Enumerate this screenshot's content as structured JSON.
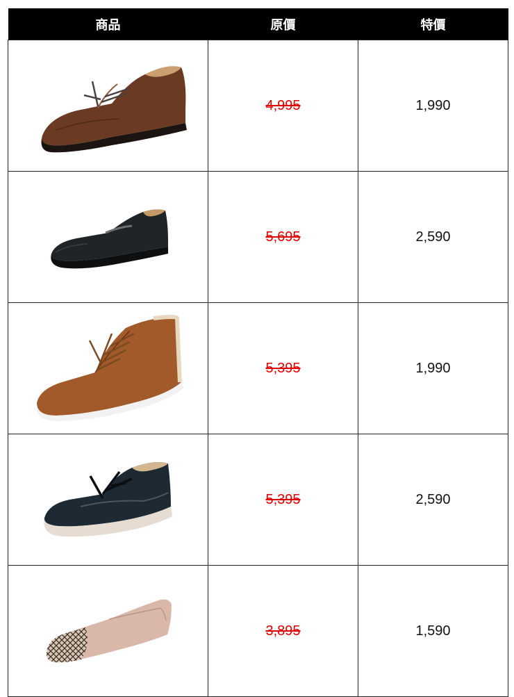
{
  "header": {
    "product": "商品",
    "original_price": "原價",
    "special_price": "特價"
  },
  "rows": [
    {
      "original_price": "4,995",
      "special_price": "1,990",
      "image": "brown-lace-up-dress-shoe"
    },
    {
      "original_price": "5,695",
      "special_price": "2,590",
      "image": "black-slip-on-loafer"
    },
    {
      "original_price": "5,395",
      "special_price": "1,990",
      "image": "tan-lace-up-ankle-boot"
    },
    {
      "original_price": "5,395",
      "special_price": "2,590",
      "image": "black-lace-up-sneaker"
    },
    {
      "original_price": "3,895",
      "special_price": "1,590",
      "image": "beige-ballet-flat-patterned-toe"
    }
  ],
  "colors": {
    "header_bg": "#000000",
    "header_text": "#ffffff",
    "strike_price": "#e00000"
  }
}
